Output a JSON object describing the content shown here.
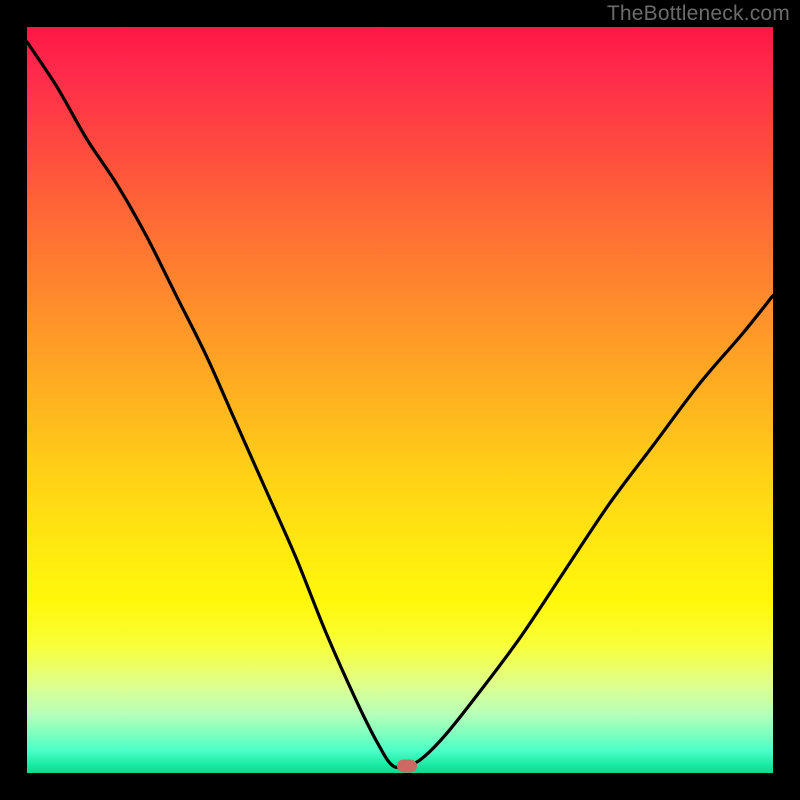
{
  "watermark": "TheBottleneck.com",
  "chart_data": {
    "type": "line",
    "title": "",
    "xlabel": "",
    "ylabel": "",
    "xlim": [
      0,
      100
    ],
    "ylim": [
      0,
      100
    ],
    "grid": false,
    "legend": false,
    "background": "rainbow-gradient-vertical",
    "series": [
      {
        "name": "bottleneck-curve",
        "color": "#000000",
        "x": [
          0,
          4,
          8,
          12,
          16,
          20,
          24,
          28,
          32,
          36,
          40,
          44,
          47,
          49,
          51,
          53,
          56,
          60,
          66,
          72,
          78,
          84,
          90,
          96,
          100
        ],
        "y": [
          98,
          92,
          85,
          79,
          72,
          64,
          56,
          47,
          38,
          29,
          19,
          10,
          4,
          1,
          1,
          2,
          5,
          10,
          18,
          27,
          36,
          44,
          52,
          59,
          64
        ]
      }
    ],
    "marker": {
      "x": 51,
      "y": 1,
      "color": "#cb6a62"
    }
  }
}
